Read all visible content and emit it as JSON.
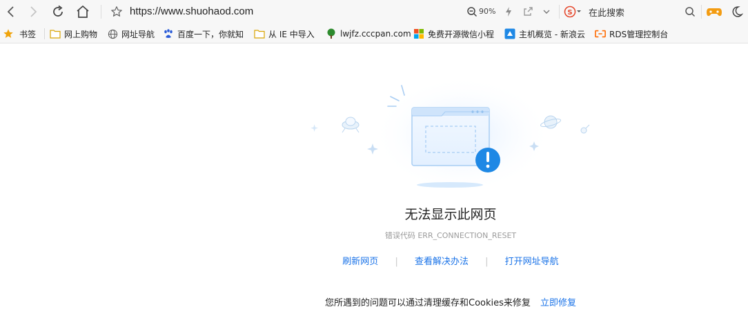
{
  "toolbar": {
    "url": "https://www.shuohaod.com",
    "zoom": "90%",
    "search_placeholder": "在此搜索",
    "colors": {
      "search_logo": "#e5482d",
      "game_icon": "#f39c12"
    }
  },
  "bookmarks": {
    "label": "书签",
    "items": [
      {
        "label": "网上购物",
        "icon": "folder-icon"
      },
      {
        "label": "网址导航",
        "icon": "globe-icon"
      },
      {
        "label": "百度一下，你就知",
        "icon": "baidu-paw-icon"
      },
      {
        "label": "从 IE 中导入",
        "icon": "folder-icon"
      },
      {
        "label": "lwjfz.cccpan.com",
        "icon": "tree-icon"
      },
      {
        "label": "免费开源微信小程",
        "icon": "windows-icon"
      },
      {
        "label": "主机概览 - 新浪云",
        "icon": "cloud-icon"
      },
      {
        "label": "RDS管理控制台",
        "icon": "aliyun-icon"
      }
    ]
  },
  "error_page": {
    "title": "无法显示此网页",
    "code_label": "错误代码 ERR_CONNECTION_RESET",
    "actions": [
      "刷新网页",
      "查看解决办法",
      "打开网址导航"
    ],
    "hint": "您所遇到的问题可以通过清理缓存和Cookies来修复",
    "hint_link": "立即修复"
  }
}
